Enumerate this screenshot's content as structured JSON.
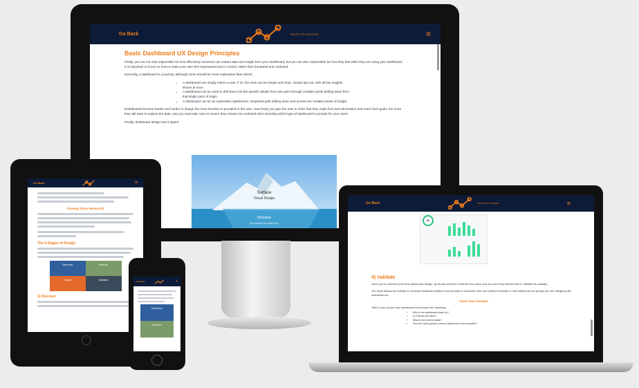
{
  "common": {
    "back_label": "Go Back",
    "menu_glyph": "≡",
    "logo_subtitle": "ROUTE TO SUCCESS",
    "accent": "#f07d1a",
    "nav_bg": "#0d1b38"
  },
  "desktop": {
    "heading": "Basic Dashboard UX Design Principles",
    "para1": "Firstly, you are not only responsible for how effectively someone can extract data and insight from your dashboard, but you are also responsible for how they feel while they are using your dashboard. It is important to focus on how to make your user feel empowered and in control, rather than frustrated and confused.",
    "para2": "Secondly, a dashboard is a journey, although some should be more explorative than others:",
    "bullets": [
      "A dashboard can simply inform a user, if so, the view can be simple and clear. Clearly laid out, with all key insights shown at once.",
      "A dashboard can be used to drill down into the specific details from one point through multiple points drilling down from that single point of origin.",
      "A dashboard can be an explorative dashboard: completed path drilling down and across into multiple points of insight."
    ],
    "para3": "Dashboards become harder and harder to design the more freedom is provided to the user. How freely you give the user in order that they might find new information and reach their goals, the more they will want to explore the data, and you must take care to ensure they remain not confused when deciding which type of dashboard to provide for your users.",
    "para4": "Finally, dashboard design has 5 layers:",
    "iceberg_surface": "Surface",
    "iceberg_visual": "Visual Design",
    "iceberg_structure": "Structure",
    "iceberg_structure_sub": "Information Architecture"
  },
  "tablet": {
    "strategy_heading": "Strategy (User Research)",
    "stages_heading": "The 4 Stages of Design",
    "grid": [
      {
        "label": "Discover",
        "color": "#2f5f9c"
      },
      {
        "label": "Nurture",
        "color": "#7c9b6a"
      },
      {
        "label": "Create",
        "color": "#e36a2a"
      },
      {
        "label": "Validate",
        "color": "#3b4a5a"
      }
    ],
    "discover_heading": "1) Discover"
  },
  "phone": {
    "discover_label": "Discover",
    "nurture_label": "Nurture"
  },
  "laptop": {
    "dashboard_kpi": "50",
    "validate_heading": "4) Validate",
    "para1": "Once you've selected your final dashboard design, go ahead and test it with the end users and see how they interact with it. Validate its usability.",
    "para2": "You must always be looking for constant feedback whether from yourself or someone else, and whether formally or informally from the people you are designing the dashboard for.",
    "sub_heading": "Great Your Designs",
    "para3": "Take a look at your own dashboard and answer the following:",
    "bullets": [
      "Who is the dashboard made for?",
      "Is it visual and clean?",
      "What is the level of detail?",
      "How are users going to keep a dashboard to be complete?"
    ]
  }
}
